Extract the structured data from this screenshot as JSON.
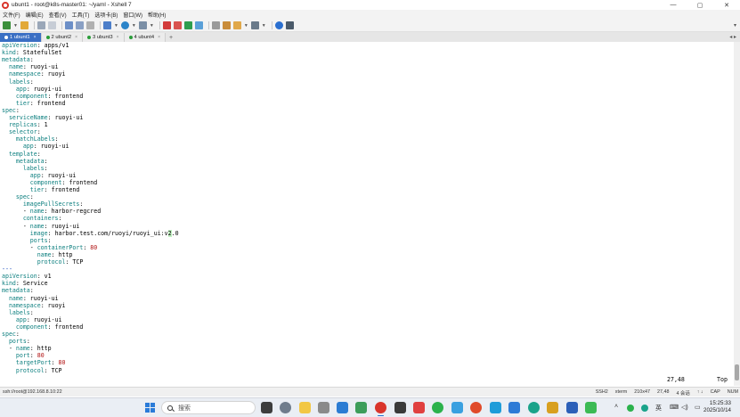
{
  "window": {
    "title": "ubunt1 - root@k8s-master01: ~/yaml - Xshell 7",
    "controls": [
      "—",
      "▢",
      "✕"
    ]
  },
  "menubar": {
    "items": [
      "文件(F)",
      "编辑(E)",
      "查看(V)",
      "工具(T)",
      "选项卡(B)",
      "窗口(W)",
      "帮助(H)"
    ]
  },
  "tabs": {
    "items": [
      {
        "label": "1 ubunt1",
        "active": true,
        "dot": "#3a6fc4"
      },
      {
        "label": "2 ubunt2",
        "active": false,
        "dot": "#2a9d3a"
      },
      {
        "label": "3 ubunt3",
        "active": false,
        "dot": "#2a9d3a"
      },
      {
        "label": "4 ubunt4",
        "active": false,
        "dot": "#2a9d3a"
      }
    ],
    "add_label": "+",
    "nav": "◂ ▸"
  },
  "terminal": {
    "lines": [
      [
        [
          "k",
          "apiVersion"
        ],
        [
          "v",
          ": apps/v1"
        ]
      ],
      [
        [
          "k",
          "kind"
        ],
        [
          "v",
          ": StatefulSet"
        ]
      ],
      [
        [
          "k",
          "metadata"
        ],
        [
          "v",
          ":"
        ]
      ],
      [
        [
          "v",
          "  "
        ],
        [
          "k",
          "name"
        ],
        [
          "v",
          ": ruoyi-ui"
        ]
      ],
      [
        [
          "v",
          "  "
        ],
        [
          "k",
          "namespace"
        ],
        [
          "v",
          ": ruoyi"
        ]
      ],
      [
        [
          "v",
          "  "
        ],
        [
          "k",
          "labels"
        ],
        [
          "v",
          ":"
        ]
      ],
      [
        [
          "v",
          "    "
        ],
        [
          "k",
          "app"
        ],
        [
          "v",
          ": ruoyi-ui"
        ]
      ],
      [
        [
          "v",
          "    "
        ],
        [
          "k",
          "component"
        ],
        [
          "v",
          ": frontend"
        ]
      ],
      [
        [
          "v",
          "    "
        ],
        [
          "k",
          "tier"
        ],
        [
          "v",
          ": frontend"
        ]
      ],
      [
        [
          "k",
          "spec"
        ],
        [
          "v",
          ":"
        ]
      ],
      [
        [
          "v",
          "  "
        ],
        [
          "k",
          "serviceName"
        ],
        [
          "v",
          ": ruoyi-ui"
        ]
      ],
      [
        [
          "v",
          "  "
        ],
        [
          "k",
          "replicas"
        ],
        [
          "v",
          ": 1"
        ]
      ],
      [
        [
          "v",
          "  "
        ],
        [
          "k",
          "selector"
        ],
        [
          "v",
          ":"
        ]
      ],
      [
        [
          "v",
          "    "
        ],
        [
          "k",
          "matchLabels"
        ],
        [
          "v",
          ":"
        ]
      ],
      [
        [
          "v",
          "      "
        ],
        [
          "k",
          "app"
        ],
        [
          "v",
          ": ruoyi-ui"
        ]
      ],
      [
        [
          "v",
          "  "
        ],
        [
          "k",
          "template"
        ],
        [
          "v",
          ":"
        ]
      ],
      [
        [
          "v",
          "    "
        ],
        [
          "k",
          "metadata"
        ],
        [
          "v",
          ":"
        ]
      ],
      [
        [
          "v",
          "      "
        ],
        [
          "k",
          "labels"
        ],
        [
          "v",
          ":"
        ]
      ],
      [
        [
          "v",
          "        "
        ],
        [
          "k",
          "app"
        ],
        [
          "v",
          ": ruoyi-ui"
        ]
      ],
      [
        [
          "v",
          "        "
        ],
        [
          "k",
          "component"
        ],
        [
          "v",
          ": frontend"
        ]
      ],
      [
        [
          "v",
          "        "
        ],
        [
          "k",
          "tier"
        ],
        [
          "v",
          ": frontend"
        ]
      ],
      [
        [
          "v",
          "    "
        ],
        [
          "k",
          "spec"
        ],
        [
          "v",
          ":"
        ]
      ],
      [
        [
          "v",
          "      "
        ],
        [
          "k",
          "imagePullSecrets"
        ],
        [
          "v",
          ":"
        ]
      ],
      [
        [
          "v",
          "      - "
        ],
        [
          "k",
          "name"
        ],
        [
          "v",
          ": harbor-regcred"
        ]
      ],
      [
        [
          "v",
          "      "
        ],
        [
          "k",
          "containers"
        ],
        [
          "v",
          ":"
        ]
      ],
      [
        [
          "v",
          "      - "
        ],
        [
          "k",
          "name"
        ],
        [
          "v",
          ": ruoyi-ui"
        ]
      ],
      [
        [
          "v",
          "        "
        ],
        [
          "k",
          "image"
        ],
        [
          "v",
          ": harbor.test.com/ruoyi/ruoyi_ui:v"
        ],
        [
          "c",
          "2"
        ],
        [
          "v",
          ".0"
        ]
      ],
      [
        [
          "v",
          "        "
        ],
        [
          "k",
          "ports"
        ],
        [
          "v",
          ":"
        ]
      ],
      [
        [
          "v",
          "        - "
        ],
        [
          "k",
          "containerPort"
        ],
        [
          "v",
          ": "
        ],
        [
          "n",
          "80"
        ]
      ],
      [
        [
          "v",
          "          "
        ],
        [
          "k",
          "name"
        ],
        [
          "v",
          ": http"
        ]
      ],
      [
        [
          "v",
          "          "
        ],
        [
          "k",
          "protocol"
        ],
        [
          "v",
          ": TCP"
        ]
      ],
      [
        [
          "s",
          "---"
        ]
      ],
      [
        [
          "k",
          "apiVersion"
        ],
        [
          "v",
          ": v1"
        ]
      ],
      [
        [
          "k",
          "kind"
        ],
        [
          "v",
          ": Service"
        ]
      ],
      [
        [
          "k",
          "metadata"
        ],
        [
          "v",
          ":"
        ]
      ],
      [
        [
          "v",
          "  "
        ],
        [
          "k",
          "name"
        ],
        [
          "v",
          ": ruoyi-ui"
        ]
      ],
      [
        [
          "v",
          "  "
        ],
        [
          "k",
          "namespace"
        ],
        [
          "v",
          ": ruoyi"
        ]
      ],
      [
        [
          "v",
          "  "
        ],
        [
          "k",
          "labels"
        ],
        [
          "v",
          ":"
        ]
      ],
      [
        [
          "v",
          "    "
        ],
        [
          "k",
          "app"
        ],
        [
          "v",
          ": ruoyi-ui"
        ]
      ],
      [
        [
          "v",
          "    "
        ],
        [
          "k",
          "component"
        ],
        [
          "v",
          ": frontend"
        ]
      ],
      [
        [
          "k",
          "spec"
        ],
        [
          "v",
          ":"
        ]
      ],
      [
        [
          "v",
          "  "
        ],
        [
          "k",
          "ports"
        ],
        [
          "v",
          ":"
        ]
      ],
      [
        [
          "v",
          "  - "
        ],
        [
          "k",
          "name"
        ],
        [
          "v",
          ": http"
        ]
      ],
      [
        [
          "v",
          "    "
        ],
        [
          "k",
          "port"
        ],
        [
          "v",
          ": "
        ],
        [
          "n",
          "80"
        ]
      ],
      [
        [
          "v",
          "    "
        ],
        [
          "k",
          "targetPort"
        ],
        [
          "v",
          ": "
        ],
        [
          "n",
          "80"
        ]
      ],
      [
        [
          "v",
          "    "
        ],
        [
          "k",
          "protocol"
        ],
        [
          "v",
          ": TCP"
        ]
      ]
    ],
    "cursor_position": "27,48",
    "scroll_indicator": "Top"
  },
  "statusbar": {
    "connection": "ssh://root@192.168.8.10:22",
    "protocol": "SSH2",
    "terminal_type": "xterm",
    "size": "210x47",
    "cursor": "27,48",
    "sessions": "4 会话",
    "arrows": "↑ ↓",
    "cap": "CAP",
    "num": "NUM"
  },
  "taskbar": {
    "search_placeholder": "搜索",
    "ime": "英",
    "time": "15:25:33",
    "date": "2025/10/14"
  },
  "colors": {
    "key": "#0f8080",
    "number": "#b01010",
    "separator": "#0a3fb5",
    "active_tab": "#3a6fc4"
  }
}
